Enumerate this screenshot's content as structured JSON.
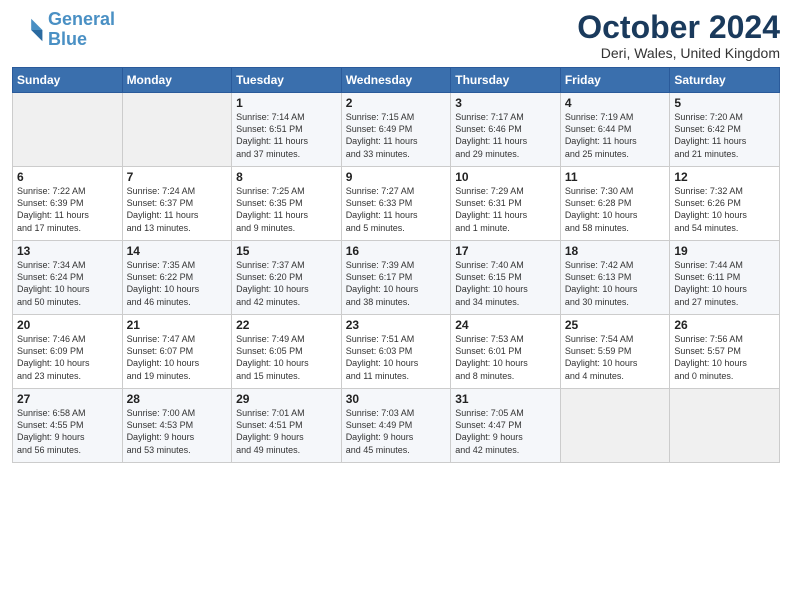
{
  "logo": {
    "line1": "General",
    "line2": "Blue"
  },
  "title": "October 2024",
  "location": "Deri, Wales, United Kingdom",
  "days_header": [
    "Sunday",
    "Monday",
    "Tuesday",
    "Wednesday",
    "Thursday",
    "Friday",
    "Saturday"
  ],
  "weeks": [
    [
      {
        "num": "",
        "info": ""
      },
      {
        "num": "",
        "info": ""
      },
      {
        "num": "1",
        "info": "Sunrise: 7:14 AM\nSunset: 6:51 PM\nDaylight: 11 hours\nand 37 minutes."
      },
      {
        "num": "2",
        "info": "Sunrise: 7:15 AM\nSunset: 6:49 PM\nDaylight: 11 hours\nand 33 minutes."
      },
      {
        "num": "3",
        "info": "Sunrise: 7:17 AM\nSunset: 6:46 PM\nDaylight: 11 hours\nand 29 minutes."
      },
      {
        "num": "4",
        "info": "Sunrise: 7:19 AM\nSunset: 6:44 PM\nDaylight: 11 hours\nand 25 minutes."
      },
      {
        "num": "5",
        "info": "Sunrise: 7:20 AM\nSunset: 6:42 PM\nDaylight: 11 hours\nand 21 minutes."
      }
    ],
    [
      {
        "num": "6",
        "info": "Sunrise: 7:22 AM\nSunset: 6:39 PM\nDaylight: 11 hours\nand 17 minutes."
      },
      {
        "num": "7",
        "info": "Sunrise: 7:24 AM\nSunset: 6:37 PM\nDaylight: 11 hours\nand 13 minutes."
      },
      {
        "num": "8",
        "info": "Sunrise: 7:25 AM\nSunset: 6:35 PM\nDaylight: 11 hours\nand 9 minutes."
      },
      {
        "num": "9",
        "info": "Sunrise: 7:27 AM\nSunset: 6:33 PM\nDaylight: 11 hours\nand 5 minutes."
      },
      {
        "num": "10",
        "info": "Sunrise: 7:29 AM\nSunset: 6:31 PM\nDaylight: 11 hours\nand 1 minute."
      },
      {
        "num": "11",
        "info": "Sunrise: 7:30 AM\nSunset: 6:28 PM\nDaylight: 10 hours\nand 58 minutes."
      },
      {
        "num": "12",
        "info": "Sunrise: 7:32 AM\nSunset: 6:26 PM\nDaylight: 10 hours\nand 54 minutes."
      }
    ],
    [
      {
        "num": "13",
        "info": "Sunrise: 7:34 AM\nSunset: 6:24 PM\nDaylight: 10 hours\nand 50 minutes."
      },
      {
        "num": "14",
        "info": "Sunrise: 7:35 AM\nSunset: 6:22 PM\nDaylight: 10 hours\nand 46 minutes."
      },
      {
        "num": "15",
        "info": "Sunrise: 7:37 AM\nSunset: 6:20 PM\nDaylight: 10 hours\nand 42 minutes."
      },
      {
        "num": "16",
        "info": "Sunrise: 7:39 AM\nSunset: 6:17 PM\nDaylight: 10 hours\nand 38 minutes."
      },
      {
        "num": "17",
        "info": "Sunrise: 7:40 AM\nSunset: 6:15 PM\nDaylight: 10 hours\nand 34 minutes."
      },
      {
        "num": "18",
        "info": "Sunrise: 7:42 AM\nSunset: 6:13 PM\nDaylight: 10 hours\nand 30 minutes."
      },
      {
        "num": "19",
        "info": "Sunrise: 7:44 AM\nSunset: 6:11 PM\nDaylight: 10 hours\nand 27 minutes."
      }
    ],
    [
      {
        "num": "20",
        "info": "Sunrise: 7:46 AM\nSunset: 6:09 PM\nDaylight: 10 hours\nand 23 minutes."
      },
      {
        "num": "21",
        "info": "Sunrise: 7:47 AM\nSunset: 6:07 PM\nDaylight: 10 hours\nand 19 minutes."
      },
      {
        "num": "22",
        "info": "Sunrise: 7:49 AM\nSunset: 6:05 PM\nDaylight: 10 hours\nand 15 minutes."
      },
      {
        "num": "23",
        "info": "Sunrise: 7:51 AM\nSunset: 6:03 PM\nDaylight: 10 hours\nand 11 minutes."
      },
      {
        "num": "24",
        "info": "Sunrise: 7:53 AM\nSunset: 6:01 PM\nDaylight: 10 hours\nand 8 minutes."
      },
      {
        "num": "25",
        "info": "Sunrise: 7:54 AM\nSunset: 5:59 PM\nDaylight: 10 hours\nand 4 minutes."
      },
      {
        "num": "26",
        "info": "Sunrise: 7:56 AM\nSunset: 5:57 PM\nDaylight: 10 hours\nand 0 minutes."
      }
    ],
    [
      {
        "num": "27",
        "info": "Sunrise: 6:58 AM\nSunset: 4:55 PM\nDaylight: 9 hours\nand 56 minutes."
      },
      {
        "num": "28",
        "info": "Sunrise: 7:00 AM\nSunset: 4:53 PM\nDaylight: 9 hours\nand 53 minutes."
      },
      {
        "num": "29",
        "info": "Sunrise: 7:01 AM\nSunset: 4:51 PM\nDaylight: 9 hours\nand 49 minutes."
      },
      {
        "num": "30",
        "info": "Sunrise: 7:03 AM\nSunset: 4:49 PM\nDaylight: 9 hours\nand 45 minutes."
      },
      {
        "num": "31",
        "info": "Sunrise: 7:05 AM\nSunset: 4:47 PM\nDaylight: 9 hours\nand 42 minutes."
      },
      {
        "num": "",
        "info": ""
      },
      {
        "num": "",
        "info": ""
      }
    ]
  ]
}
